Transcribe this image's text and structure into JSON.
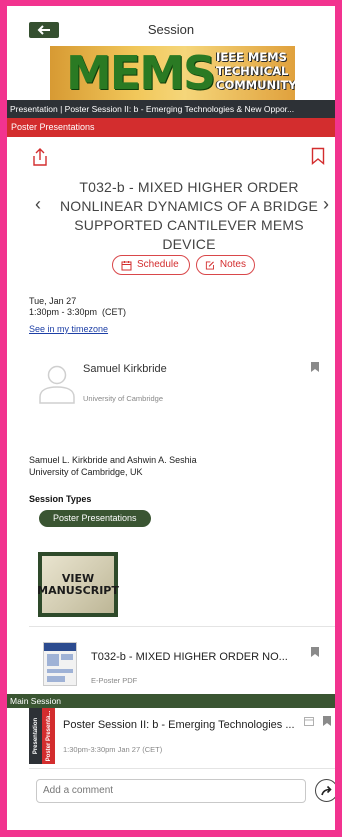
{
  "header": {
    "title": "Session",
    "back_icon": "arrow-left-icon"
  },
  "banner": {
    "logo_text": "MEMS",
    "sub_line1": "IEEE MEMS",
    "sub_line2": "TECHNICAL",
    "sub_line3": "COMMUNITY"
  },
  "breadcrumb": "Presentation | Poster Session II: b - Emerging Technologies & New Oppor...",
  "category": "Poster Presentations",
  "presentation": {
    "title_line1": "T032-b - MIXED HIGHER ORDER",
    "title_line2": "NONLINEAR DYNAMICS OF A BRIDGE",
    "title_line3": "SUPPORTED CANTILEVER MEMS DEVICE",
    "prev_glyph": "‹",
    "next_glyph": "›"
  },
  "actions": {
    "schedule_label": "Schedule",
    "notes_label": "Notes"
  },
  "datetime": {
    "date": "Tue, Jan 27",
    "time": "1:30pm - 3:30pm  (CET)",
    "timezone_link": "See in my timezone"
  },
  "speaker": {
    "name": "Samuel Kirkbride",
    "affiliation": "University of Cambridge"
  },
  "authors": {
    "line1": "Samuel L. Kirkbride and Ashwin A. Seshia",
    "line2": "University of Cambridge, UK"
  },
  "session_types": {
    "label": "Session Types",
    "chip": "Poster Presentations"
  },
  "manuscript": {
    "line1": "VIEW",
    "line2": "MANUSCRIPT"
  },
  "poster": {
    "title": "T032-b - MIXED HIGHER ORDER NO...",
    "subtitle": "E-Poster PDF"
  },
  "main_session": {
    "bar_label": "Main Session",
    "tab_a": "Presentation",
    "tab_b": "Poster Presenta...",
    "title": "Poster Session II: b - Emerging Technologies ...",
    "time": "1:30pm-3:30pm Jan 27 (CET)"
  },
  "comment": {
    "placeholder": "Add a comment"
  },
  "colors": {
    "frame": "#f2338f",
    "accent_red": "#d32d2e",
    "accent_green": "#3a5532",
    "dark_bar": "#2d3136",
    "link": "#1d3fa6"
  }
}
